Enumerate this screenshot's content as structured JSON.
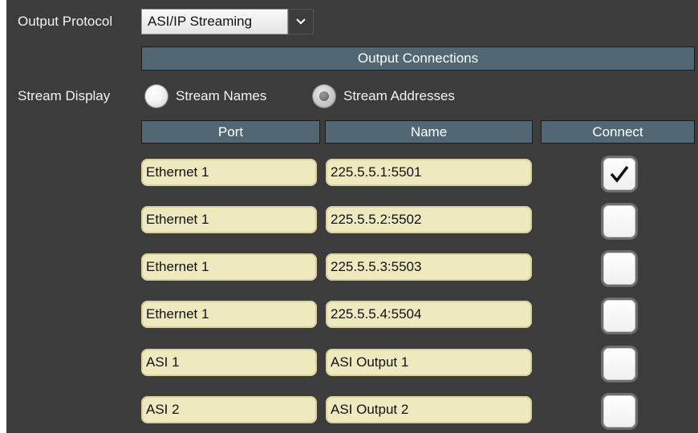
{
  "output_protocol": {
    "label": "Output Protocol",
    "selected_value": "ASI/IP Streaming"
  },
  "section": {
    "title": "Output Connections"
  },
  "stream_display": {
    "label": "Stream Display",
    "options": [
      {
        "label": "Stream Names",
        "selected": false
      },
      {
        "label": "Stream Addresses",
        "selected": true
      }
    ]
  },
  "table": {
    "headers": [
      "Port",
      "Name",
      "Connect"
    ],
    "rows": [
      {
        "port": "Ethernet 1",
        "name": "225.5.5.1:5501",
        "connected": true
      },
      {
        "port": "Ethernet 1",
        "name": "225.5.5.2:5502",
        "connected": false
      },
      {
        "port": "Ethernet 1",
        "name": "225.5.5.3:5503",
        "connected": false
      },
      {
        "port": "Ethernet 1",
        "name": "225.5.5.4:5504",
        "connected": false
      },
      {
        "port": "ASI 1",
        "name": "ASI Output 1",
        "connected": false
      },
      {
        "port": "ASI 2",
        "name": "ASI Output 2",
        "connected": false
      }
    ]
  },
  "colors": {
    "panel_background": "#3c3c3c",
    "header_bar": "#516874",
    "field_background": "#efe9bf"
  },
  "icons": {
    "dropdown": "chevron-down-icon",
    "checked": "checkmark-icon"
  }
}
